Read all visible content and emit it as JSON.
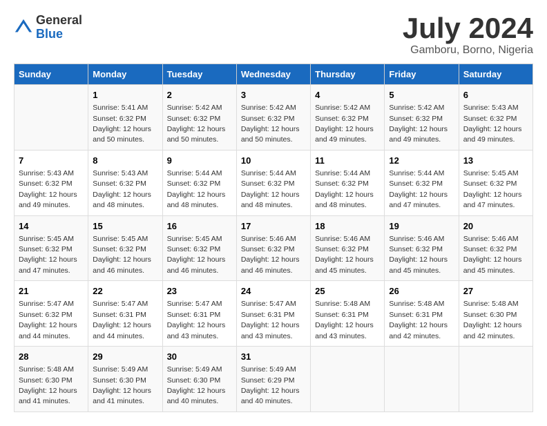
{
  "logo": {
    "general": "General",
    "blue": "Blue"
  },
  "title": "July 2024",
  "subtitle": "Gamboru, Borno, Nigeria",
  "days_header": [
    "Sunday",
    "Monday",
    "Tuesday",
    "Wednesday",
    "Thursday",
    "Friday",
    "Saturday"
  ],
  "weeks": [
    [
      {
        "day": "",
        "info": ""
      },
      {
        "day": "1",
        "info": "Sunrise: 5:41 AM\nSunset: 6:32 PM\nDaylight: 12 hours\nand 50 minutes."
      },
      {
        "day": "2",
        "info": "Sunrise: 5:42 AM\nSunset: 6:32 PM\nDaylight: 12 hours\nand 50 minutes."
      },
      {
        "day": "3",
        "info": "Sunrise: 5:42 AM\nSunset: 6:32 PM\nDaylight: 12 hours\nand 50 minutes."
      },
      {
        "day": "4",
        "info": "Sunrise: 5:42 AM\nSunset: 6:32 PM\nDaylight: 12 hours\nand 49 minutes."
      },
      {
        "day": "5",
        "info": "Sunrise: 5:42 AM\nSunset: 6:32 PM\nDaylight: 12 hours\nand 49 minutes."
      },
      {
        "day": "6",
        "info": "Sunrise: 5:43 AM\nSunset: 6:32 PM\nDaylight: 12 hours\nand 49 minutes."
      }
    ],
    [
      {
        "day": "7",
        "info": "Sunrise: 5:43 AM\nSunset: 6:32 PM\nDaylight: 12 hours\nand 49 minutes."
      },
      {
        "day": "8",
        "info": "Sunrise: 5:43 AM\nSunset: 6:32 PM\nDaylight: 12 hours\nand 48 minutes."
      },
      {
        "day": "9",
        "info": "Sunrise: 5:44 AM\nSunset: 6:32 PM\nDaylight: 12 hours\nand 48 minutes."
      },
      {
        "day": "10",
        "info": "Sunrise: 5:44 AM\nSunset: 6:32 PM\nDaylight: 12 hours\nand 48 minutes."
      },
      {
        "day": "11",
        "info": "Sunrise: 5:44 AM\nSunset: 6:32 PM\nDaylight: 12 hours\nand 48 minutes."
      },
      {
        "day": "12",
        "info": "Sunrise: 5:44 AM\nSunset: 6:32 PM\nDaylight: 12 hours\nand 47 minutes."
      },
      {
        "day": "13",
        "info": "Sunrise: 5:45 AM\nSunset: 6:32 PM\nDaylight: 12 hours\nand 47 minutes."
      }
    ],
    [
      {
        "day": "14",
        "info": "Sunrise: 5:45 AM\nSunset: 6:32 PM\nDaylight: 12 hours\nand 47 minutes."
      },
      {
        "day": "15",
        "info": "Sunrise: 5:45 AM\nSunset: 6:32 PM\nDaylight: 12 hours\nand 46 minutes."
      },
      {
        "day": "16",
        "info": "Sunrise: 5:45 AM\nSunset: 6:32 PM\nDaylight: 12 hours\nand 46 minutes."
      },
      {
        "day": "17",
        "info": "Sunrise: 5:46 AM\nSunset: 6:32 PM\nDaylight: 12 hours\nand 46 minutes."
      },
      {
        "day": "18",
        "info": "Sunrise: 5:46 AM\nSunset: 6:32 PM\nDaylight: 12 hours\nand 45 minutes."
      },
      {
        "day": "19",
        "info": "Sunrise: 5:46 AM\nSunset: 6:32 PM\nDaylight: 12 hours\nand 45 minutes."
      },
      {
        "day": "20",
        "info": "Sunrise: 5:46 AM\nSunset: 6:32 PM\nDaylight: 12 hours\nand 45 minutes."
      }
    ],
    [
      {
        "day": "21",
        "info": "Sunrise: 5:47 AM\nSunset: 6:32 PM\nDaylight: 12 hours\nand 44 minutes."
      },
      {
        "day": "22",
        "info": "Sunrise: 5:47 AM\nSunset: 6:31 PM\nDaylight: 12 hours\nand 44 minutes."
      },
      {
        "day": "23",
        "info": "Sunrise: 5:47 AM\nSunset: 6:31 PM\nDaylight: 12 hours\nand 43 minutes."
      },
      {
        "day": "24",
        "info": "Sunrise: 5:47 AM\nSunset: 6:31 PM\nDaylight: 12 hours\nand 43 minutes."
      },
      {
        "day": "25",
        "info": "Sunrise: 5:48 AM\nSunset: 6:31 PM\nDaylight: 12 hours\nand 43 minutes."
      },
      {
        "day": "26",
        "info": "Sunrise: 5:48 AM\nSunset: 6:31 PM\nDaylight: 12 hours\nand 42 minutes."
      },
      {
        "day": "27",
        "info": "Sunrise: 5:48 AM\nSunset: 6:30 PM\nDaylight: 12 hours\nand 42 minutes."
      }
    ],
    [
      {
        "day": "28",
        "info": "Sunrise: 5:48 AM\nSunset: 6:30 PM\nDaylight: 12 hours\nand 41 minutes."
      },
      {
        "day": "29",
        "info": "Sunrise: 5:49 AM\nSunset: 6:30 PM\nDaylight: 12 hours\nand 41 minutes."
      },
      {
        "day": "30",
        "info": "Sunrise: 5:49 AM\nSunset: 6:30 PM\nDaylight: 12 hours\nand 40 minutes."
      },
      {
        "day": "31",
        "info": "Sunrise: 5:49 AM\nSunset: 6:29 PM\nDaylight: 12 hours\nand 40 minutes."
      },
      {
        "day": "",
        "info": ""
      },
      {
        "day": "",
        "info": ""
      },
      {
        "day": "",
        "info": ""
      }
    ]
  ]
}
